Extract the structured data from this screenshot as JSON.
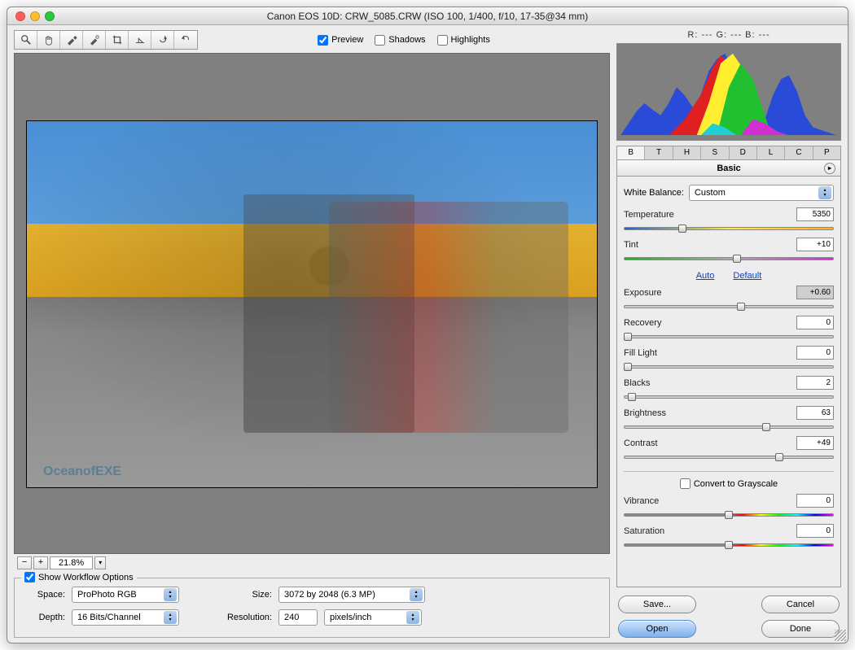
{
  "title": "Canon EOS 10D:  CRW_5085.CRW  (ISO 100, 1/400, f/10, 17-35@34 mm)",
  "toolbar": {
    "preview_label": "Preview",
    "shadows_label": "Shadows",
    "highlights_label": "Highlights",
    "preview_checked": true,
    "shadows_checked": false,
    "highlights_checked": false
  },
  "rgb_readout": "R: ---   G: ---   B: ---",
  "zoom": {
    "value": "21.8%"
  },
  "workflow": {
    "show_label": "Show Workflow Options",
    "space_label": "Space:",
    "space_value": "ProPhoto RGB",
    "depth_label": "Depth:",
    "depth_value": "16 Bits/Channel",
    "size_label": "Size:",
    "size_value": "3072 by 2048  (6.3 MP)",
    "resolution_label": "Resolution:",
    "resolution_value": "240",
    "resolution_units": "pixels/inch"
  },
  "tabs": [
    "B",
    "T",
    "H",
    "S",
    "D",
    "L",
    "C",
    "P"
  ],
  "panel_title": "Basic",
  "wb": {
    "label": "White Balance:",
    "value": "Custom"
  },
  "sliders": {
    "temperature": {
      "label": "Temperature",
      "value": "5350",
      "pos": 28,
      "track": "temp"
    },
    "tint": {
      "label": "Tint",
      "value": "+10",
      "pos": 54,
      "track": "tint"
    },
    "exposure": {
      "label": "Exposure",
      "value": "+0.60",
      "pos": 56,
      "hl": true
    },
    "recovery": {
      "label": "Recovery",
      "value": "0",
      "pos": 2
    },
    "fill_light": {
      "label": "Fill Light",
      "value": "0",
      "pos": 2
    },
    "blacks": {
      "label": "Blacks",
      "value": "2",
      "pos": 4
    },
    "brightness": {
      "label": "Brightness",
      "value": "63",
      "pos": 68
    },
    "contrast": {
      "label": "Contrast",
      "value": "+49",
      "pos": 74
    },
    "vibrance": {
      "label": "Vibrance",
      "value": "0",
      "pos": 50,
      "track": "vib"
    },
    "saturation": {
      "label": "Saturation",
      "value": "0",
      "pos": 50,
      "track": "vib"
    }
  },
  "links": {
    "auto": "Auto",
    "default": "Default"
  },
  "grayscale_label": "Convert to Grayscale",
  "buttons": {
    "save": "Save...",
    "open": "Open",
    "cancel": "Cancel",
    "done": "Done"
  },
  "watermark": "OceanofEXE"
}
